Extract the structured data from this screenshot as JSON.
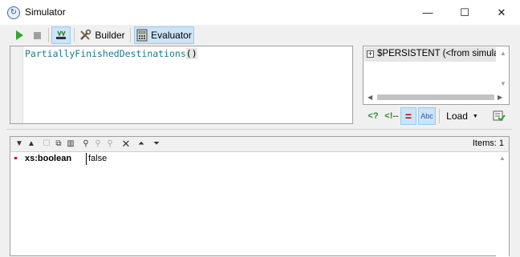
{
  "window": {
    "title": "Simulator",
    "minimize_glyph": "—",
    "maximize_glyph": "☐",
    "close_glyph": "✕"
  },
  "toolbar": {
    "builder_label": "Builder",
    "evaluator_label": "Evaluator"
  },
  "expression": {
    "name": "PartiallyFinishedDestinations",
    "args": "()"
  },
  "variables": {
    "items": [
      {
        "toggle": "+",
        "label": "$PERSISTENT (<from simulato"
      }
    ]
  },
  "var_tools": {
    "load_label": "Load",
    "xpath_icon": "<?",
    "step_icon": "<!--",
    "equals_icon": "=",
    "abc_icon": "Abc"
  },
  "results": {
    "items_label": "Items:",
    "items_count": "1",
    "rows": [
      {
        "type": "xs:boolean",
        "value": "false"
      }
    ]
  },
  "colors": {
    "accent": "#cce4f7",
    "play": "#2fa52f",
    "expression": "#1a7a8a",
    "bullet": "#c00000"
  }
}
